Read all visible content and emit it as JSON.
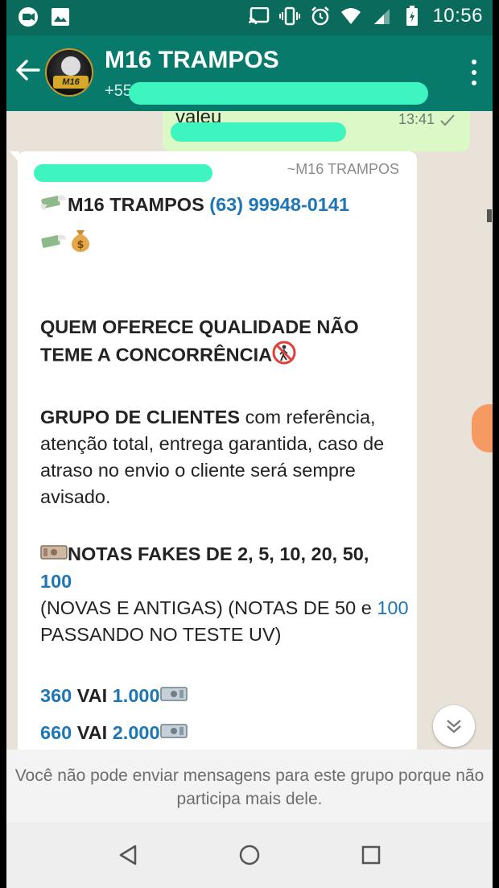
{
  "status_bar": {
    "time": "10:56",
    "icons": [
      "notification-icon",
      "image-icon",
      "cast-icon",
      "vibrate-icon",
      "alarm-icon",
      "wifi-icon",
      "signal-icon",
      "battery-charging-icon"
    ]
  },
  "header": {
    "title": "M16 TRAMPOS",
    "subtitle": "+55",
    "avatar_badge": "M16"
  },
  "chat": {
    "outgoing": {
      "text": "valeu",
      "time": "13:41"
    },
    "incoming": {
      "sender": "~M16 TRAMPOS",
      "line1_bold": "M16 TRAMPOS",
      "line1_phone": "(63) 99948-0141",
      "headline": "QUEM OFERECE QUALIDADE NÃO TEME A CONCORRÊNCIA",
      "group_bold": "GRUPO DE CLIENTES",
      "group_text": " com referência, atenção total, entrega garantida, caso de atraso no envio o cliente será sempre avisado.",
      "notes_bold": "NOTAS FAKES DE 2, 5, 10, 20, 50,",
      "notes_100": "100",
      "notes_text_a": "(NOVAS E ANTIGAS) (NOTAS DE 50 e ",
      "notes_text_100": "100",
      "notes_text_b": " PASSANDO NO TESTE UV)",
      "offer1_a": "360",
      "offer1_mid": " VAI ",
      "offer1_b": "1.000",
      "offer2_a": "660",
      "offer2_mid": " VAI ",
      "offer2_b": "2.000"
    }
  },
  "footer": {
    "notice": "Você não pode enviar mensagens para este grupo porque não participa mais dele."
  },
  "colors": {
    "status_bar": "#0a6b5c",
    "app_bar": "#087a6c",
    "link": "#1e76b5",
    "outgoing_bubble": "#dcf8c6",
    "redaction": "#3ef5bf"
  }
}
